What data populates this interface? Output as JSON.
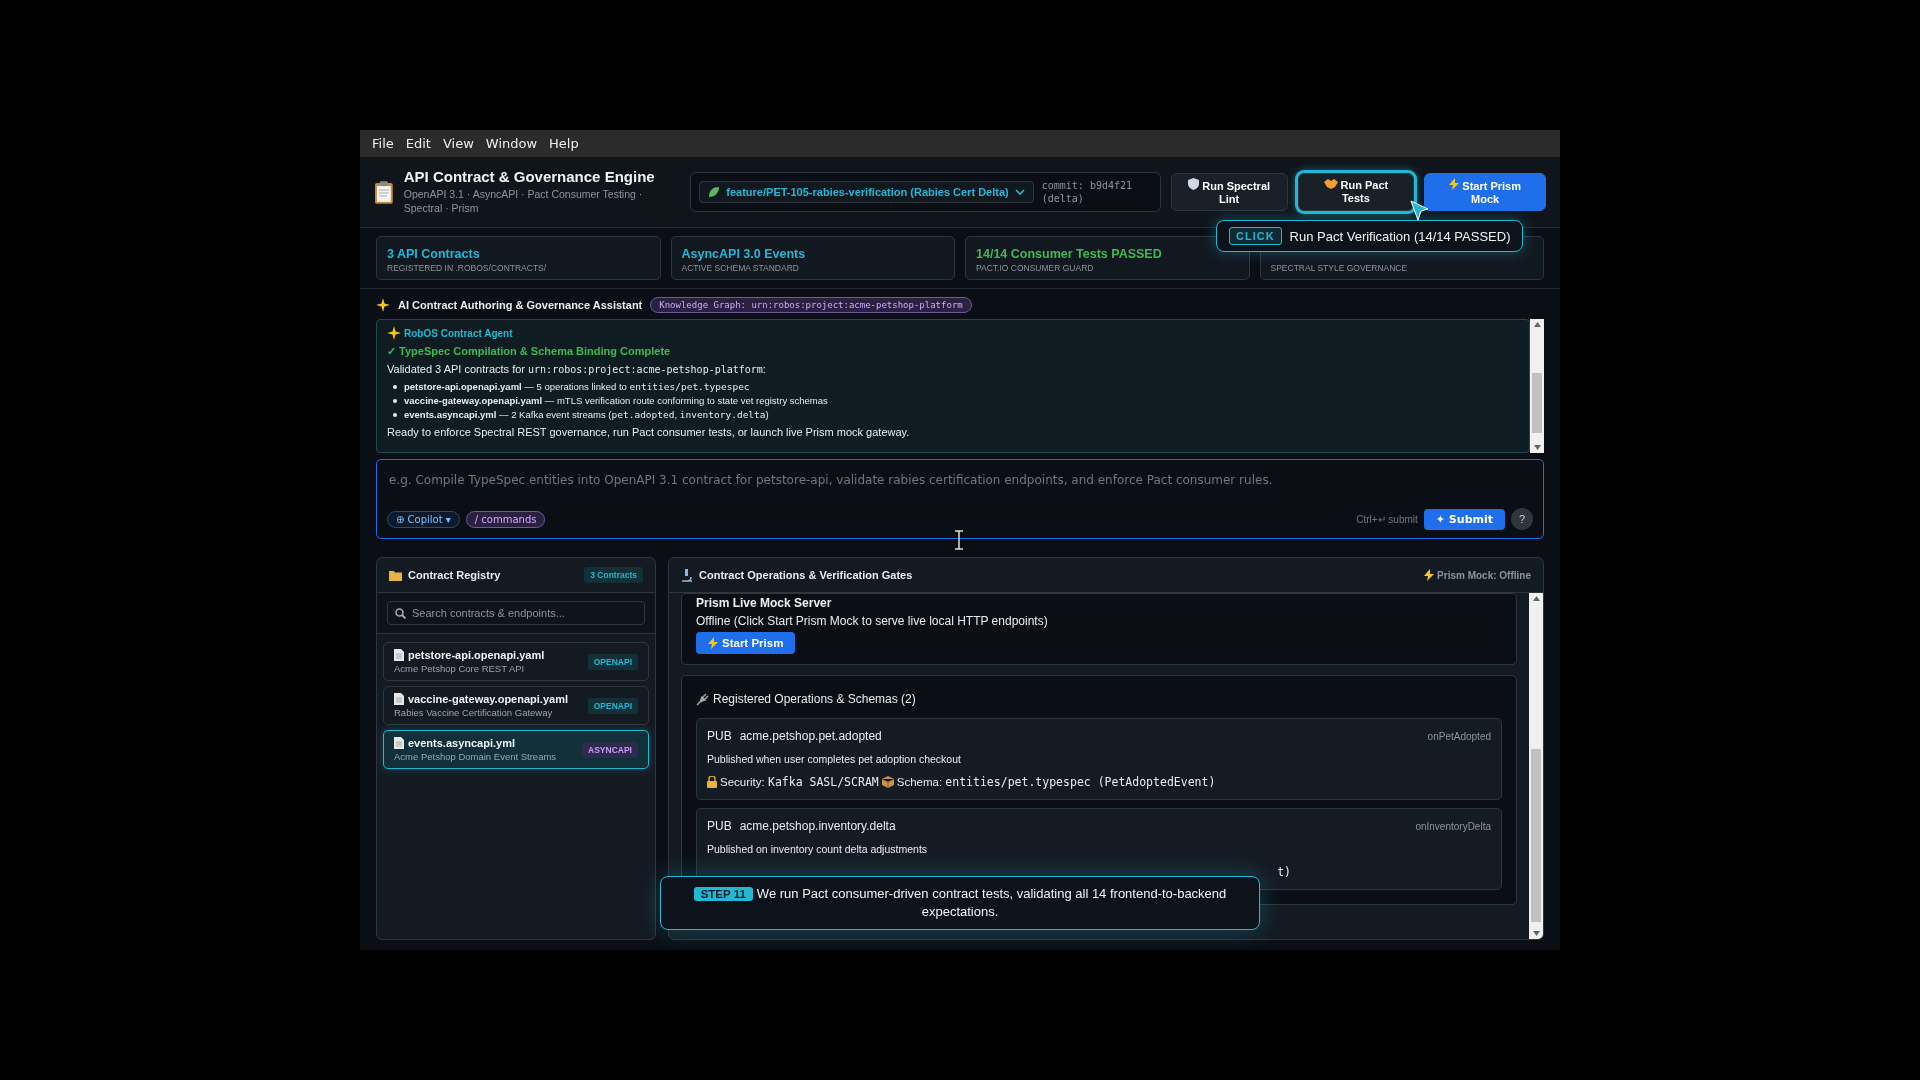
{
  "menu": [
    "File",
    "Edit",
    "View",
    "Window",
    "Help"
  ],
  "app": {
    "title": "API Contract & Governance Engine",
    "subtitle": "OpenAPI 3.1 · AsyncAPI · Pact Consumer Testing · Spectral · Prism"
  },
  "branch": {
    "label": "feature/PET-105-rabies-verification (Rabies Cert Delta)"
  },
  "commit": "commit: b9d4f21 (delta)",
  "actions": [
    {
      "label": "Run Spectral Lint",
      "kind": "secondary",
      "focused": false
    },
    {
      "label": "Run Pact Tests",
      "kind": "secondary",
      "focused": true
    },
    {
      "label": "Start Prism Mock",
      "kind": "primary",
      "focused": false
    }
  ],
  "stats": [
    {
      "title": "3 API Contracts",
      "caption": "REGISTERED IN .ROBOS/CONTRACTS/",
      "kind": "info"
    },
    {
      "title": "AsyncAPI 3.0 Events",
      "caption": "ACTIVE SCHEMA STANDARD",
      "kind": "info"
    },
    {
      "title": "14/14 Consumer Tests PASSED",
      "caption": "PACT.IO CONSUMER GUARD",
      "kind": "success"
    },
    {
      "caption": "SPECTRAL STYLE GOVERNANCE"
    }
  ],
  "assistant": {
    "title": "AI Contract Authoring & Governance Assistant",
    "graph_chip": "Knowledge Graph: urn:robos:project:acme-petshop-platform",
    "agent": "RobOS Contract Agent",
    "heading": "✓ TypeSpec Compilation & Schema Binding Complete",
    "intro": [
      {
        "text": "Validated 3 API contracts for ",
        "kind": "text"
      },
      {
        "text": "urn:robos:project:acme-petshop-platform",
        "kind": "code"
      },
      {
        "text": ":",
        "kind": "text"
      }
    ],
    "items": [
      {
        "file": "petstore-api.openapi.yaml",
        "parts": [
          {
            "text": " — 5 operations linked to ",
            "kind": "text"
          },
          {
            "text": "entities/pet.typespec",
            "kind": "code"
          }
        ]
      },
      {
        "file": "vaccine-gateway.openapi.yaml",
        "parts": [
          {
            "text": " — mTLS verification route conforming to state vet registry schemas",
            "kind": "text"
          }
        ]
      },
      {
        "file": "events.asyncapi.yml",
        "parts": [
          {
            "text": " — 2 Kafka event streams (",
            "kind": "text"
          },
          {
            "text": "pet.adopted",
            "kind": "code"
          },
          {
            "text": ", ",
            "kind": "text"
          },
          {
            "text": "inventory.delta",
            "kind": "code"
          },
          {
            "text": ")",
            "kind": "text"
          }
        ]
      }
    ],
    "footer": "Ready to enforce Spectral REST governance, run Pact consumer tests, or launch live Prism mock gateway."
  },
  "composer": {
    "placeholder": "e.g. Compile TypeSpec entities into OpenAPI 3.1 contract for petstore-api, validate rabies certification endpoints, and enforce Pact consumer rules.",
    "copilot": "⊕ Copilot ▾",
    "commands": "/ commands",
    "hint": "Ctrl+↵ submit",
    "submit": "✦ Submit",
    "help": "?"
  },
  "registry": {
    "title": "Contract Registry",
    "count": "3 Contracts",
    "search_placeholder": "Search contracts & endpoints...",
    "contracts": [
      {
        "file": "petstore-api.openapi.yaml",
        "description": "Acme Petshop Core REST API",
        "tag": "OPENAPI",
        "kind": "openapi",
        "selected": false
      },
      {
        "file": "vaccine-gateway.openapi.yaml",
        "description": "Rabies Vaccine Certification Gateway",
        "tag": "OPENAPI",
        "kind": "openapi",
        "selected": false
      },
      {
        "file": "events.asyncapi.yml",
        "description": "Acme Petshop Domain Event Streams",
        "tag": "ASYNCAPI",
        "kind": "asyncapi",
        "selected": true
      }
    ]
  },
  "operations_panel": {
    "title": "Contract Operations & Verification Gates",
    "status": "Prism Mock: Offline",
    "prism": {
      "title": "Prism Live Mock Server",
      "text": "Offline (Click Start Prism Mock to serve live local HTTP endpoints)",
      "button": "Start Prism"
    },
    "ops_title": "Registered Operations & Schemas (2)",
    "operations": [
      {
        "verb": "PUB",
        "name": "acme.petshop.pet.adopted",
        "handler": "onPetAdopted",
        "description": "Published when user completes pet adoption checkout",
        "security_label": "Security:",
        "security_value": "Kafka SASL/SCRAM",
        "schema_label": "Schema:",
        "schema_value": "entities/pet.typespec (PetAdoptedEvent)"
      },
      {
        "verb": "PUB",
        "name": "acme.petshop.inventory.delta",
        "handler": "onInventoryDelta",
        "description": "Published on inventory count delta adjustments",
        "tail": "t)"
      }
    ]
  },
  "tooltip": {
    "badge": "CLICK",
    "text": "Run Pact Verification (14/14 PASSED)"
  },
  "step": {
    "badge": "STEP 11",
    "text": "We run Pact consumer-driven contract tests, validating all 14 frontend-to-backend expectations."
  }
}
